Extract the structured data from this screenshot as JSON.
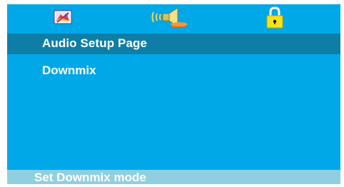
{
  "tabs": [
    {
      "icon": "general-setup-icon"
    },
    {
      "icon": "speaker-icon"
    },
    {
      "icon": "padlock-icon"
    }
  ],
  "page": {
    "title": "Audio Setup Page"
  },
  "menu": {
    "items": [
      {
        "label": "Downmix"
      }
    ]
  },
  "status": {
    "text": "Set Downmix mode"
  },
  "colors": {
    "background": "#00a8e8",
    "title_bar": "#0f7ea6",
    "status_bar": "#8fcfe0",
    "text": "#ffffff"
  }
}
